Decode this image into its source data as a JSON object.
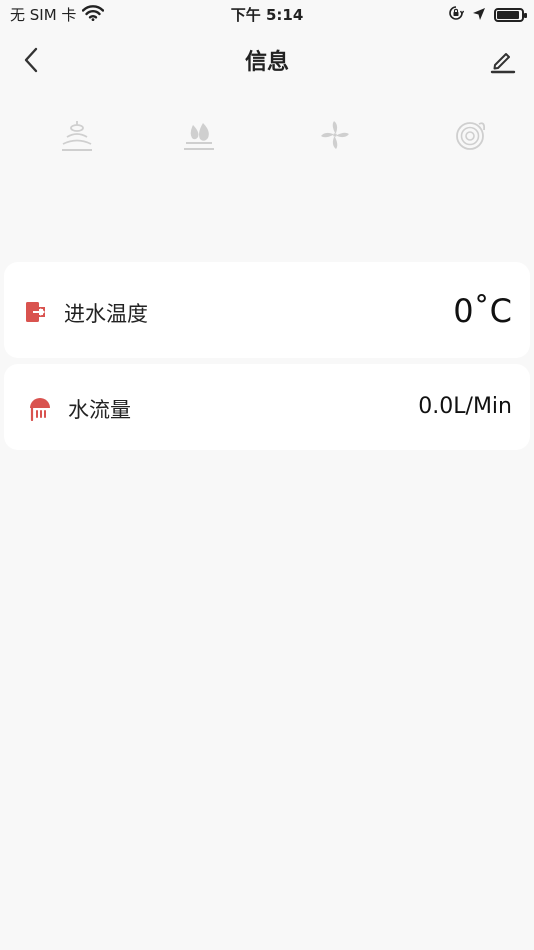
{
  "status_bar": {
    "carrier": "无 SIM 卡",
    "time": "下午 5:14",
    "battery_level": 0.9
  },
  "header": {
    "title": "信息"
  },
  "modes": [
    {
      "icon": "fountain-icon"
    },
    {
      "icon": "water-flame-icon"
    },
    {
      "icon": "fan-icon"
    },
    {
      "icon": "spiral-icon"
    }
  ],
  "info": {
    "inlet_temperature": {
      "label": "进水温度",
      "value": "0˚C",
      "icon": "inlet-door-icon",
      "icon_color": "#d9534f"
    },
    "water_flow": {
      "label": "水流量",
      "value": "0.0L/Min",
      "icon": "shower-icon",
      "icon_color": "#d9534f"
    }
  },
  "colors": {
    "background": "#f8f8f8",
    "card": "#ffffff",
    "accent": "#d9534f",
    "muted_icon": "#cfcfcf"
  }
}
